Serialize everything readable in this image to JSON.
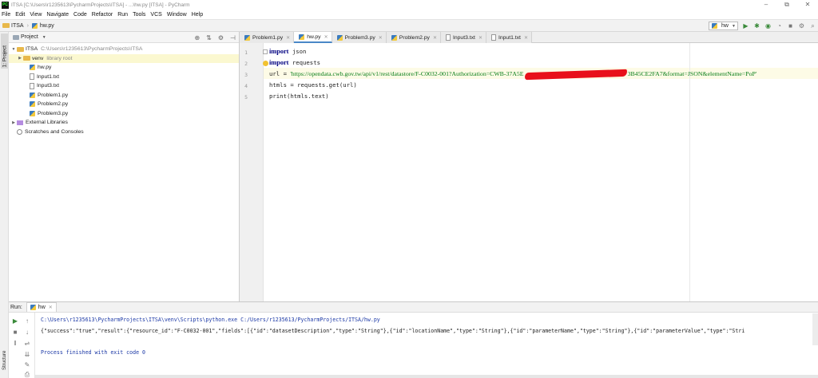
{
  "window": {
    "title": "ITSA [C:\\Users\\r1235613\\PycharmProjects\\ITSA] - ...\\hw.py [ITSA] - PyCharm",
    "minimize": "–",
    "restore": "⧉",
    "close": "✕"
  },
  "menu": [
    "File",
    "Edit",
    "View",
    "Navigate",
    "Code",
    "Refactor",
    "Run",
    "Tools",
    "VCS",
    "Window",
    "Help"
  ],
  "breadcrumb": {
    "project": "ITSA",
    "file": "hw.py"
  },
  "run_config": {
    "selected": "hw"
  },
  "left_tool_tab": "1: Project",
  "project_panel": {
    "title": "Project",
    "tree": [
      {
        "name": "ITSA",
        "detail": "C:\\Users\\r1235613\\PycharmProjects\\ITSA",
        "kind": "folder",
        "indent": 0,
        "expanded": true
      },
      {
        "name": "venv",
        "detail": "library root",
        "kind": "folder",
        "indent": 1,
        "collapsed": true,
        "highlight": true
      },
      {
        "name": "hw.py",
        "detail": "",
        "kind": "py",
        "indent": 2
      },
      {
        "name": "Input1.txt",
        "detail": "",
        "kind": "txt",
        "indent": 2
      },
      {
        "name": "Input3.txt",
        "detail": "",
        "kind": "txt",
        "indent": 2
      },
      {
        "name": "Problem1.py",
        "detail": "",
        "kind": "py",
        "indent": 2
      },
      {
        "name": "Problem2.py",
        "detail": "",
        "kind": "py",
        "indent": 2
      },
      {
        "name": "Problem3.py",
        "detail": "",
        "kind": "py",
        "indent": 2
      },
      {
        "name": "External Libraries",
        "detail": "",
        "kind": "lib",
        "indent": 0,
        "collapsed": true
      },
      {
        "name": "Scratches and Consoles",
        "detail": "",
        "kind": "scratch",
        "indent": 0
      }
    ]
  },
  "editor_tabs": [
    {
      "label": "Problem1.py",
      "kind": "py",
      "active": false
    },
    {
      "label": "hw.py",
      "kind": "py",
      "active": true
    },
    {
      "label": "Problem3.py",
      "kind": "py",
      "active": false
    },
    {
      "label": "Problem2.py",
      "kind": "py",
      "active": false
    },
    {
      "label": "Input3.txt",
      "kind": "txt",
      "active": false
    },
    {
      "label": "Input1.txt",
      "kind": "txt",
      "active": false
    }
  ],
  "code": {
    "line_numbers": [
      "1",
      "2",
      "3",
      "4",
      "5"
    ],
    "line1": {
      "kw": "import",
      "rest": " json"
    },
    "line2": {
      "kw": "import",
      "rest": " requests"
    },
    "line3": {
      "prefix": "url = ",
      "str_start": "'https://opendata.cwb.gov.tw/api/v1/rest/datastore/F-C0032-001?Authorization=CWB-37A5E",
      "str_end": "3B45CE2FA7&format=JSON&elementName=PoP'"
    },
    "line4": "htmls = requests.get(url)",
    "line5": "print(htmls.text)"
  },
  "run_panel": {
    "label": "Run:",
    "tab": "hw",
    "console": [
      {
        "text": "C:\\Users\\r1235613\\PycharmProjects\\ITSA\\venv\\Scripts\\python.exe C:/Users/r1235613/PycharmProjects/ITSA/hw.py",
        "style": "blue"
      },
      {
        "text": "{\"success\":\"true\",\"result\":{\"resource_id\":\"F-C0032-001\",\"fields\":[{\"id\":\"datasetDescription\",\"type\":\"String\"},{\"id\":\"locationName\",\"type\":\"String\"},{\"id\":\"parameterName\",\"type\":\"String\"},{\"id\":\"parameterValue\",\"type\":\"Stri",
        "style": "blk"
      },
      {
        "text": "",
        "style": "blk"
      },
      {
        "text": "Process finished with exit code 0",
        "style": "blue"
      }
    ]
  },
  "bottom_tool_tab": "Structure"
}
